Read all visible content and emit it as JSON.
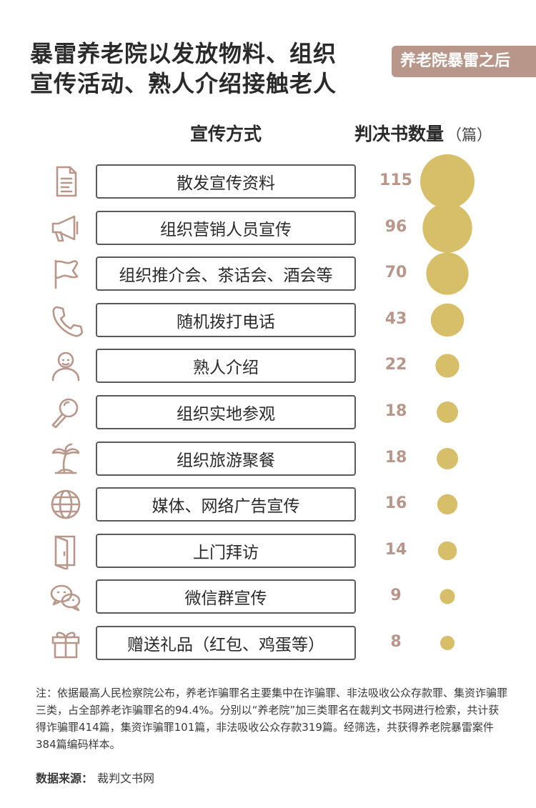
{
  "title_lines": [
    "暴雷养老院以发放物料、组织",
    "宣传活动、熟人介绍接触老人"
  ],
  "badge": "养老院暴雷之后",
  "column_headers": {
    "method": "宣传方式",
    "count": "判决书数量",
    "unit": "（篇）"
  },
  "colors": {
    "bubble": "#d7bf6a",
    "value_text": "#b8968a",
    "badge_bg": "#b8968a",
    "icon_stroke": "#b8968a"
  },
  "chart_data": {
    "type": "bubble",
    "categories": [
      "散发宣传资料",
      "组织营销人员宣传",
      "组织推介会、茶话会、酒会等",
      "随机拨打电话",
      "熟人介绍",
      "组织实地参观",
      "组织旅游聚餐",
      "媒体、网络广告宣传",
      "上门拜访",
      "微信群宣传",
      "赠送礼品（红包、鸡蛋等）"
    ],
    "values": [
      115,
      96,
      70,
      43,
      22,
      18,
      18,
      16,
      14,
      9,
      8
    ],
    "icons": [
      "document-icon",
      "megaphone-icon",
      "flag-icon",
      "phone-icon",
      "person-icon",
      "magnifier-icon",
      "palm-tree-icon",
      "globe-icon",
      "door-icon",
      "wechat-icon",
      "gift-icon"
    ]
  },
  "note": "注：依据最高人民检察院公布，养老诈骗罪名主要集中在诈骗罪、非法吸收公众存款罪、集资诈骗罪三类，占全部养老诈骗罪名的94.4%。分别以“养老院”加三类罪名在裁判文书网进行检索，共计获得诈骗罪414篇，集资诈骗罪101篇，非法吸收公众存款319篇。经筛选，共获得养老院暴雷案件384篇编码样本。",
  "source": {
    "label": "数据来源：",
    "value": "裁判文书网"
  }
}
